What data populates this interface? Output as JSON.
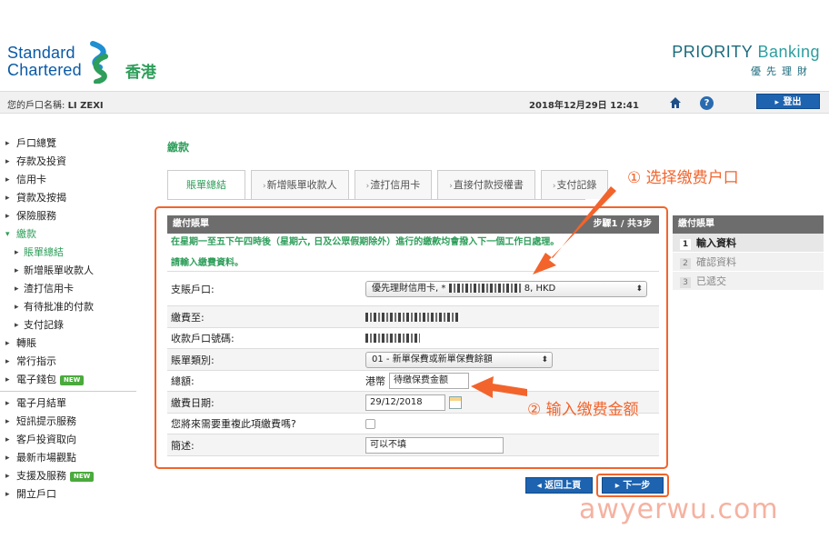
{
  "brand": {
    "line1": "Standard",
    "line2": "Chartered",
    "region": "香港",
    "priority_title": "PRIORITY",
    "priority_banking": "Banking",
    "priority_sub": "優先理財"
  },
  "account_bar": {
    "name_label": "您的戶口名稱:",
    "name_value": "LI ZEXI",
    "datetime": "2018年12月29日 12:41",
    "logout": "登出",
    "help": "?"
  },
  "sidebar": {
    "items": [
      {
        "label": "戶口總覽"
      },
      {
        "label": "存款及投資"
      },
      {
        "label": "信用卡"
      },
      {
        "label": "貸款及按揭"
      },
      {
        "label": "保險服務"
      },
      {
        "label": "繳款"
      },
      {
        "label": "賬單總結"
      },
      {
        "label": "新增賬單收款人"
      },
      {
        "label": "渣打信用卡"
      },
      {
        "label": "有待批准的付款"
      },
      {
        "label": "支付記錄"
      },
      {
        "label": "轉賬"
      },
      {
        "label": "常行指示"
      },
      {
        "label": "電子錢包"
      },
      {
        "label": "電子月結單"
      },
      {
        "label": "短訊提示服務"
      },
      {
        "label": "客戶投資取向"
      },
      {
        "label": "最新市場觀點"
      },
      {
        "label": "支援及服務"
      },
      {
        "label": "開立戶口"
      }
    ],
    "new_badge": "NEW"
  },
  "main": {
    "title": "繳款",
    "tabs": [
      "賬單總結",
      "新增賬單收款人",
      "渣打信用卡",
      "直接付款授權書",
      "支付記錄"
    ]
  },
  "form": {
    "header": "繳付賬單",
    "step": "步驟1 / 共3步",
    "notice": "在星期一至五下午四時後（星期六, 日及公眾假期除外）進行的繳款均會撥入下一個工作日處理。",
    "prompt": "請輸入繳費資料。",
    "rows": {
      "debit_label": "支賬戶口:",
      "debit_value": "優先理財信用卡, *",
      "debit_suffix": "8, HKD",
      "payee_label": "繳費至:",
      "receiver_label": "收款戶口號碼:",
      "bill_type_label": "賬單類別:",
      "bill_type_value": "01 - 新單保費或新單保費餘額",
      "amount_label": "總額:",
      "currency": "港幣",
      "amount_value": "待缴保费金额",
      "date_label": "繳費日期:",
      "date_value": "29/12/2018",
      "repeat_label": "您將來需要重複此項繳費嗎?",
      "memo_label": "簡述:",
      "memo_value": "可以不填"
    }
  },
  "steps_panel": {
    "header": "繳付賬單",
    "steps": [
      {
        "num": "1",
        "label": "輸入資料"
      },
      {
        "num": "2",
        "label": "確認資料"
      },
      {
        "num": "3",
        "label": "已遞交"
      }
    ]
  },
  "buttons": {
    "back": "返回上頁",
    "next": "下一步"
  },
  "annotations": {
    "a1": "① 选择缴费户口",
    "a2": "② 输入缴费金额"
  },
  "watermark": "awyerwu.com",
  "colors": {
    "accent_green": "#2e9e5a",
    "brand_blue": "#0a5aa8",
    "button_blue": "#1d63b0",
    "annotation_orange": "#f2642c"
  }
}
